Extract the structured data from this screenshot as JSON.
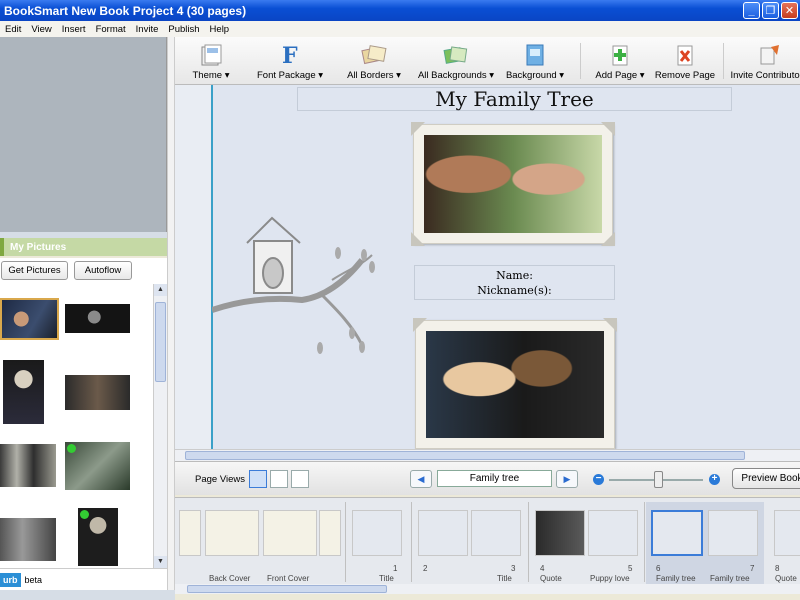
{
  "window": {
    "title": "BookSmart New Book Project 4 (30 pages)",
    "controls": [
      "_",
      "❐",
      "✕"
    ]
  },
  "menu": [
    "Edit",
    "View",
    "Insert",
    "Format",
    "Invite",
    "Publish",
    "Help"
  ],
  "left_panel": {
    "section_title": "My Pictures",
    "get_pictures_label": "Get Pictures",
    "autoflow_label": "Autoflow",
    "blurb_logo": "urb",
    "blurb_beta": "beta"
  },
  "toolbar": {
    "theme": "Theme ▾",
    "font_package": "Font Package ▾",
    "all_borders": "All Borders ▾",
    "all_backgrounds": "All Backgrounds ▾",
    "background": "Background ▾",
    "add_page": "Add Page ▾",
    "remove_page": "Remove Page",
    "invite_contributors": "Invite Contributors"
  },
  "page": {
    "title": "My Family Tree",
    "name_label": "Name:",
    "nickname_label": "Nickname(s):"
  },
  "page_views": {
    "label": "Page Views",
    "current_page_name": "Family tree",
    "preview_label": "Preview Book"
  },
  "strip": {
    "spreads": [
      {
        "left_caption": "Back Cover",
        "right_caption": "Front Cover"
      },
      {
        "right_num": "1",
        "right_caption": "Title"
      },
      {
        "left_num": "2",
        "right_num": "3",
        "right_caption": "Title"
      },
      {
        "left_num": "4",
        "left_caption": "Quote",
        "right_num": "5",
        "right_caption": "Puppy love"
      },
      {
        "left_num": "6",
        "left_caption": "Family tree",
        "right_num": "7",
        "right_caption": "Family tree"
      },
      {
        "left_num": "8",
        "left_caption": "Quote"
      }
    ]
  },
  "colors": {
    "title_bar": "#0a4fd4",
    "accent_green": "#c5d9a5",
    "page_bg": "#dfe5f0",
    "page_edge": "#3aa0c8"
  }
}
